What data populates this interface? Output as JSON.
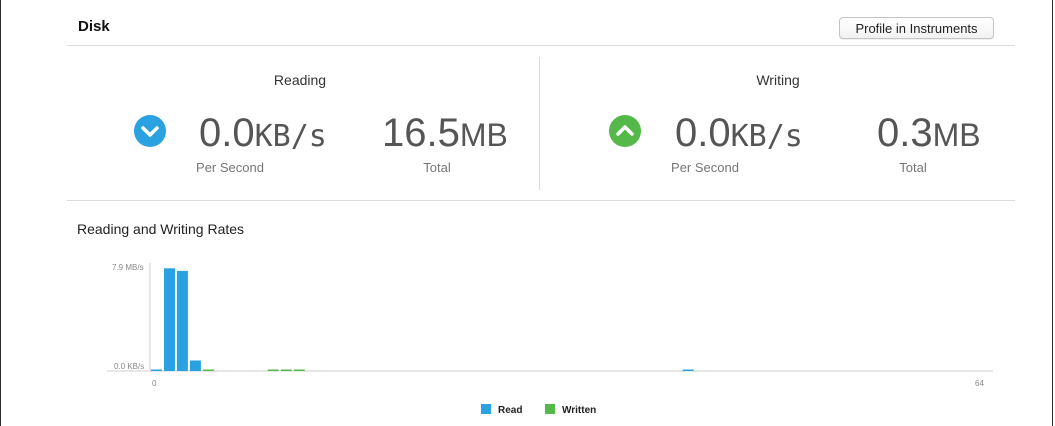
{
  "header": {
    "title": "Disk",
    "profile_button": "Profile in Instruments"
  },
  "reading": {
    "title": "Reading",
    "rate_value": "0.0",
    "rate_unit": "KB/s",
    "rate_label": "Per Second",
    "total_value": "16.5",
    "total_unit": "MB",
    "total_label": "Total",
    "icon": "chevron-down-circle-icon",
    "color": "#2aa1e0"
  },
  "writing": {
    "title": "Writing",
    "rate_value": "0.0",
    "rate_unit": "KB/s",
    "rate_label": "Per Second",
    "total_value": "0.3",
    "total_unit": "MB",
    "total_label": "Total",
    "icon": "chevron-up-circle-icon",
    "color": "#55b94a"
  },
  "chart_data": {
    "type": "bar",
    "title": "Reading and Writing Rates",
    "y_ticks": [
      "7.9 MB/s",
      "0.0 KB/s"
    ],
    "x_ticks": [
      "0",
      "64"
    ],
    "ylim": [
      0,
      7.9
    ],
    "xlim": [
      0,
      64
    ],
    "series": [
      {
        "name": "Read",
        "color": "#2aa1e0",
        "points": [
          [
            0,
            0.1
          ],
          [
            1,
            7.8
          ],
          [
            2,
            7.6
          ],
          [
            3,
            0.8
          ],
          [
            41,
            0.05
          ]
        ]
      },
      {
        "name": "Written",
        "color": "#55b94a",
        "points": [
          [
            4,
            0.05
          ],
          [
            9,
            0.05
          ],
          [
            10,
            0.05
          ],
          [
            11,
            0.05
          ]
        ]
      }
    ]
  }
}
